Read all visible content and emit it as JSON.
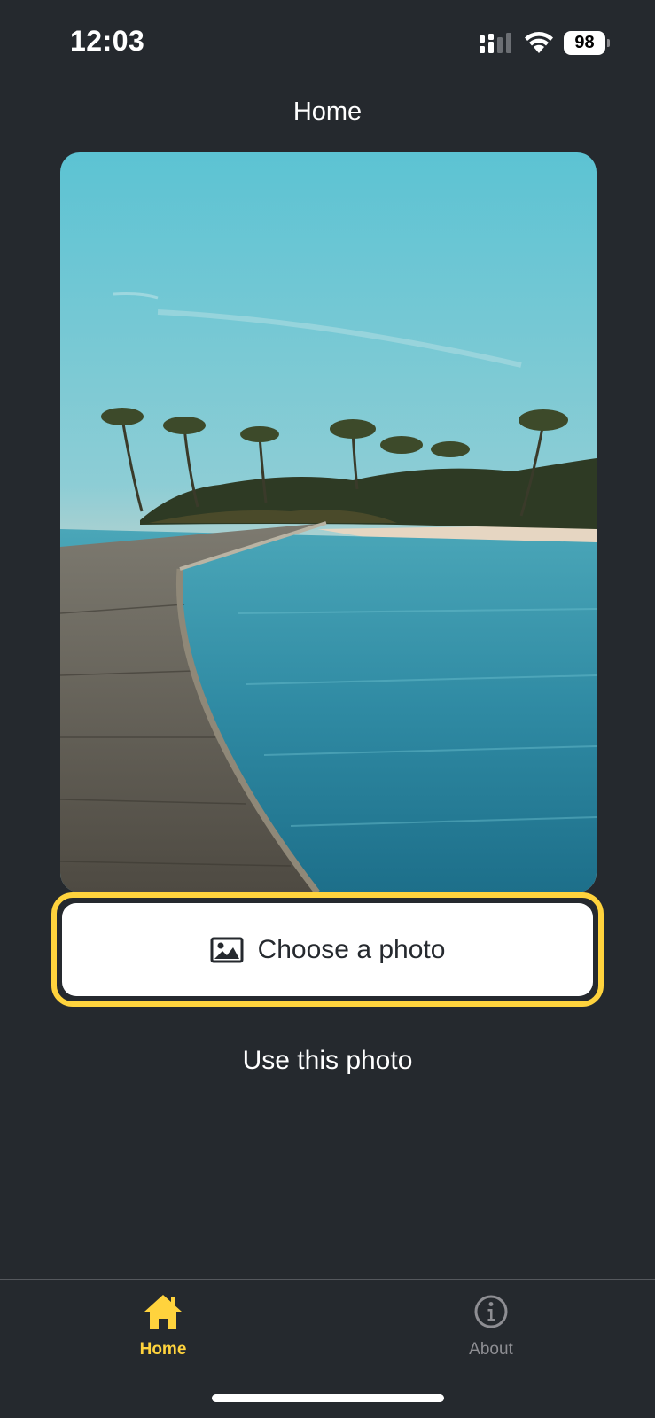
{
  "status_bar": {
    "time": "12:03",
    "battery_level": "98",
    "signal_icon": "cellular-signal-icon",
    "wifi_icon": "wifi-icon"
  },
  "header": {
    "title": "Home"
  },
  "photo": {
    "icon": "beach-boardwalk-photo"
  },
  "actions": {
    "choose_label": "Choose a photo",
    "choose_icon": "picture-icon",
    "use_label": "Use this photo"
  },
  "tabs": [
    {
      "label": "Home",
      "icon": "home-icon",
      "active": true
    },
    {
      "label": "About",
      "icon": "info-icon",
      "active": false
    }
  ],
  "colors": {
    "background": "#25292e",
    "accent": "#ffd33d",
    "button_bg": "#ffffff",
    "inactive_tab": "#8e8e93"
  }
}
